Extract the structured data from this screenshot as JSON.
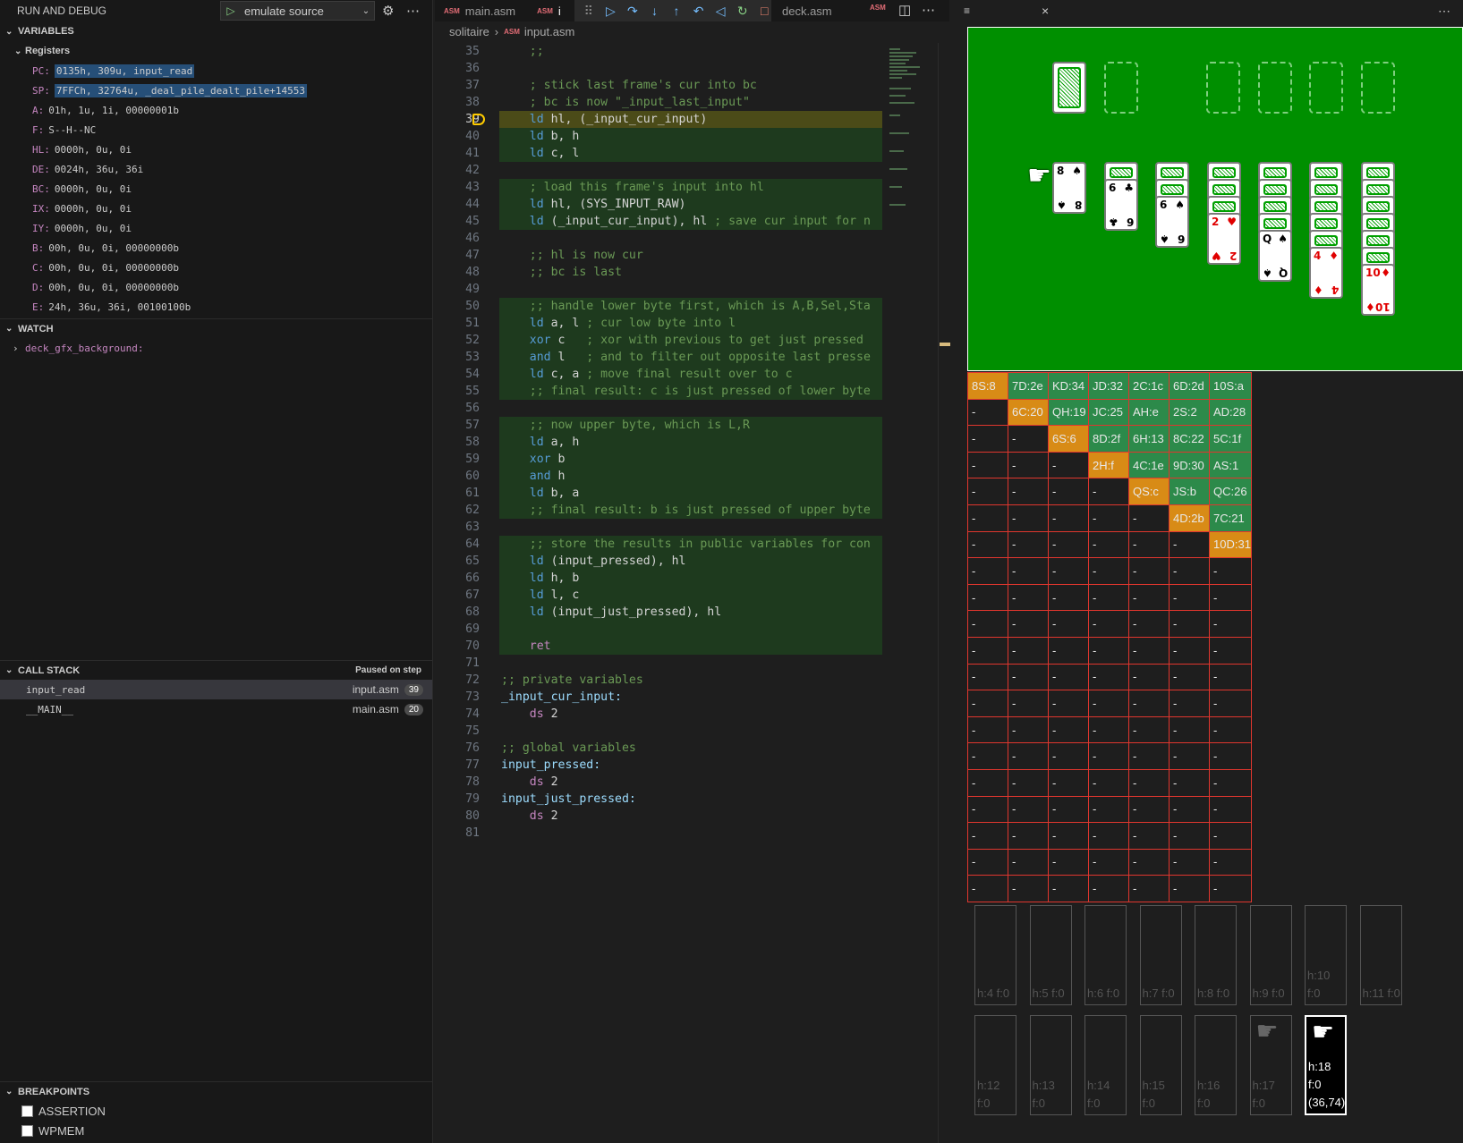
{
  "sidebar": {
    "title": "RUN AND DEBUG",
    "config_label": "emulate source",
    "variables_title": "VARIABLES",
    "registers_title": "Registers",
    "registers": [
      {
        "k": "PC:",
        "v": "0135h, 309u, input_read",
        "hl": true
      },
      {
        "k": "SP:",
        "v": "7FFCh, 32764u, _deal_pile_dealt_pile+14553",
        "hl": true
      },
      {
        "k": "A:",
        "v": "01h, 1u, 1i, 00000001b",
        "hl": false
      },
      {
        "k": "F:",
        "v": "S--H--NC",
        "hl": false
      },
      {
        "k": "HL:",
        "v": "0000h, 0u, 0i",
        "hl": false
      },
      {
        "k": "DE:",
        "v": "0024h, 36u, 36i",
        "hl": false
      },
      {
        "k": "BC:",
        "v": "0000h, 0u, 0i",
        "hl": false
      },
      {
        "k": "IX:",
        "v": "0000h, 0u, 0i",
        "hl": false
      },
      {
        "k": "IY:",
        "v": "0000h, 0u, 0i",
        "hl": false
      },
      {
        "k": "B:",
        "v": "00h, 0u, 0i, 00000000b",
        "hl": false
      },
      {
        "k": "C:",
        "v": "00h, 0u, 0i, 00000000b",
        "hl": false
      },
      {
        "k": "D:",
        "v": "00h, 0u, 0i, 00000000b",
        "hl": false
      },
      {
        "k": "E:",
        "v": "24h, 36u, 36i, 00100100b",
        "hl": false
      }
    ],
    "watch_title": "WATCH",
    "watch_item": "deck_gfx_background:",
    "callstack_title": "CALL STACK",
    "callstack_status": "Paused on step",
    "callstack": [
      {
        "name": "input_read",
        "file": "input.asm",
        "line": "39"
      },
      {
        "name": "__MAIN__",
        "file": "main.asm",
        "line": "20"
      }
    ],
    "breakpoints_title": "BREAKPOINTS",
    "breakpoints": [
      "ASSERTION",
      "WPMEM"
    ]
  },
  "editor": {
    "tabs": [
      "main.asm",
      "i",
      "deck.asm"
    ],
    "breadcrumb": [
      "solitaire",
      "input.asm"
    ],
    "asm_badge": "ASM",
    "lines": [
      {
        "n": "35",
        "t": "    ;;"
      },
      {
        "n": "36",
        "t": ""
      },
      {
        "n": "37",
        "t": "    ; stick last frame's cur into bc"
      },
      {
        "n": "38",
        "t": "    ; bc is now \"_input_last_input\""
      },
      {
        "n": "39",
        "t": "    ld hl, (_input_cur_input)"
      },
      {
        "n": "40",
        "t": "    ld b, h"
      },
      {
        "n": "41",
        "t": "    ld c, l"
      },
      {
        "n": "42",
        "t": ""
      },
      {
        "n": "43",
        "t": "    ; load this frame's input into hl"
      },
      {
        "n": "44",
        "t": "    ld hl, (SYS_INPUT_RAW)"
      },
      {
        "n": "45",
        "t": "    ld (_input_cur_input), hl ; save cur input for n"
      },
      {
        "n": "46",
        "t": ""
      },
      {
        "n": "47",
        "t": "    ;; hl is now cur"
      },
      {
        "n": "48",
        "t": "    ;; bc is last"
      },
      {
        "n": "49",
        "t": ""
      },
      {
        "n": "50",
        "t": "    ;; handle lower byte first, which is A,B,Sel,Sta"
      },
      {
        "n": "51",
        "t": "    ld a, l ; cur low byte into l"
      },
      {
        "n": "52",
        "t": "    xor c   ; xor with previous to get just pressed"
      },
      {
        "n": "53",
        "t": "    and l   ; and to filter out opposite last presse"
      },
      {
        "n": "54",
        "t": "    ld c, a ; move final result over to c"
      },
      {
        "n": "55",
        "t": "    ;; final result: c is just pressed of lower byte"
      },
      {
        "n": "56",
        "t": ""
      },
      {
        "n": "57",
        "t": "    ;; now upper byte, which is L,R"
      },
      {
        "n": "58",
        "t": "    ld a, h"
      },
      {
        "n": "59",
        "t": "    xor b"
      },
      {
        "n": "60",
        "t": "    and h"
      },
      {
        "n": "61",
        "t": "    ld b, a"
      },
      {
        "n": "62",
        "t": "    ;; final result: b is just pressed of upper byte"
      },
      {
        "n": "63",
        "t": ""
      },
      {
        "n": "64",
        "t": "    ;; store the results in public variables for con"
      },
      {
        "n": "65",
        "t": "    ld (input_pressed), hl"
      },
      {
        "n": "66",
        "t": "    ld h, b"
      },
      {
        "n": "67",
        "t": "    ld l, c"
      },
      {
        "n": "68",
        "t": "    ld (input_just_pressed), hl"
      },
      {
        "n": "69",
        "t": ""
      },
      {
        "n": "70",
        "t": "    ret"
      },
      {
        "n": "71",
        "t": ""
      },
      {
        "n": "72",
        "t": ";; private variables"
      },
      {
        "n": "73",
        "t": "_input_cur_input:"
      },
      {
        "n": "74",
        "t": "    ds 2"
      },
      {
        "n": "75",
        "t": ""
      },
      {
        "n": "76",
        "t": ";; global variables"
      },
      {
        "n": "77",
        "t": "input_pressed:"
      },
      {
        "n": "78",
        "t": "    ds 2"
      },
      {
        "n": "79",
        "t": "input_just_pressed:"
      },
      {
        "n": "80",
        "t": "    ds 2"
      },
      {
        "n": "81",
        "t": ""
      }
    ],
    "current_line": "39"
  },
  "grid": [
    [
      "8S:8",
      "7D:2e",
      "KD:34",
      "JD:32",
      "2C:1c",
      "6D:2d",
      "10S:a"
    ],
    [
      "-",
      "6C:20",
      "QH:19",
      "JC:25",
      "AH:e",
      "2S:2",
      "AD:28"
    ],
    [
      "-",
      "-",
      "6S:6",
      "8D:2f",
      "6H:13",
      "8C:22",
      "5C:1f"
    ],
    [
      "-",
      "-",
      "-",
      "2H:f",
      "4C:1e",
      "9D:30",
      "AS:1"
    ],
    [
      "-",
      "-",
      "-",
      "-",
      "QS:c",
      "JS:b",
      "QC:26"
    ],
    [
      "-",
      "-",
      "-",
      "-",
      "-",
      "4D:2b",
      "7C:21"
    ],
    [
      "-",
      "-",
      "-",
      "-",
      "-",
      "-",
      "10D:31"
    ],
    [
      "-",
      "-",
      "-",
      "-",
      "-",
      "-",
      "-"
    ],
    [
      "-",
      "-",
      "-",
      "-",
      "-",
      "-",
      "-"
    ],
    [
      "-",
      "-",
      "-",
      "-",
      "-",
      "-",
      "-"
    ],
    [
      "-",
      "-",
      "-",
      "-",
      "-",
      "-",
      "-"
    ],
    [
      "-",
      "-",
      "-",
      "-",
      "-",
      "-",
      "-"
    ],
    [
      "-",
      "-",
      "-",
      "-",
      "-",
      "-",
      "-"
    ],
    [
      "-",
      "-",
      "-",
      "-",
      "-",
      "-",
      "-"
    ],
    [
      "-",
      "-",
      "-",
      "-",
      "-",
      "-",
      "-"
    ],
    [
      "-",
      "-",
      "-",
      "-",
      "-",
      "-",
      "-"
    ],
    [
      "-",
      "-",
      "-",
      "-",
      "-",
      "-",
      "-"
    ],
    [
      "-",
      "-",
      "-",
      "-",
      "-",
      "-",
      "-"
    ],
    [
      "-",
      "-",
      "-",
      "-",
      "-",
      "-",
      "-"
    ],
    [
      "-",
      "-",
      "-",
      "-",
      "-",
      "-",
      "-"
    ]
  ],
  "game": {
    "tableau": [
      {
        "rank": "8",
        "suit": "♠",
        "color": "dark"
      },
      {
        "rank": "6",
        "suit": "♣",
        "color": "dark"
      },
      {
        "rank": "6",
        "suit": "♠",
        "color": "dark"
      },
      {
        "rank": "2",
        "suit": "♥",
        "color": "red"
      },
      {
        "rank": "Q",
        "suit": "♠",
        "color": "dark"
      },
      {
        "rank": "4",
        "suit": "♦",
        "color": "red"
      },
      {
        "rank": "10",
        "suit": "♦",
        "color": "red"
      }
    ]
  },
  "sprites_row1": [
    "h:4 f:0",
    "h:5 f:0",
    "h:6 f:0",
    "h:7 f:0",
    "h:8 f:0",
    "h:9 f:0",
    "h:10 f:0",
    "h:11 f:0"
  ],
  "sprites_row2": [
    "h:12 f:0",
    "h:13 f:0",
    "h:14 f:0",
    "h:15 f:0",
    "h:16 f:0",
    "h:17 f:0",
    "h:18 f:0 (36,74)"
  ]
}
